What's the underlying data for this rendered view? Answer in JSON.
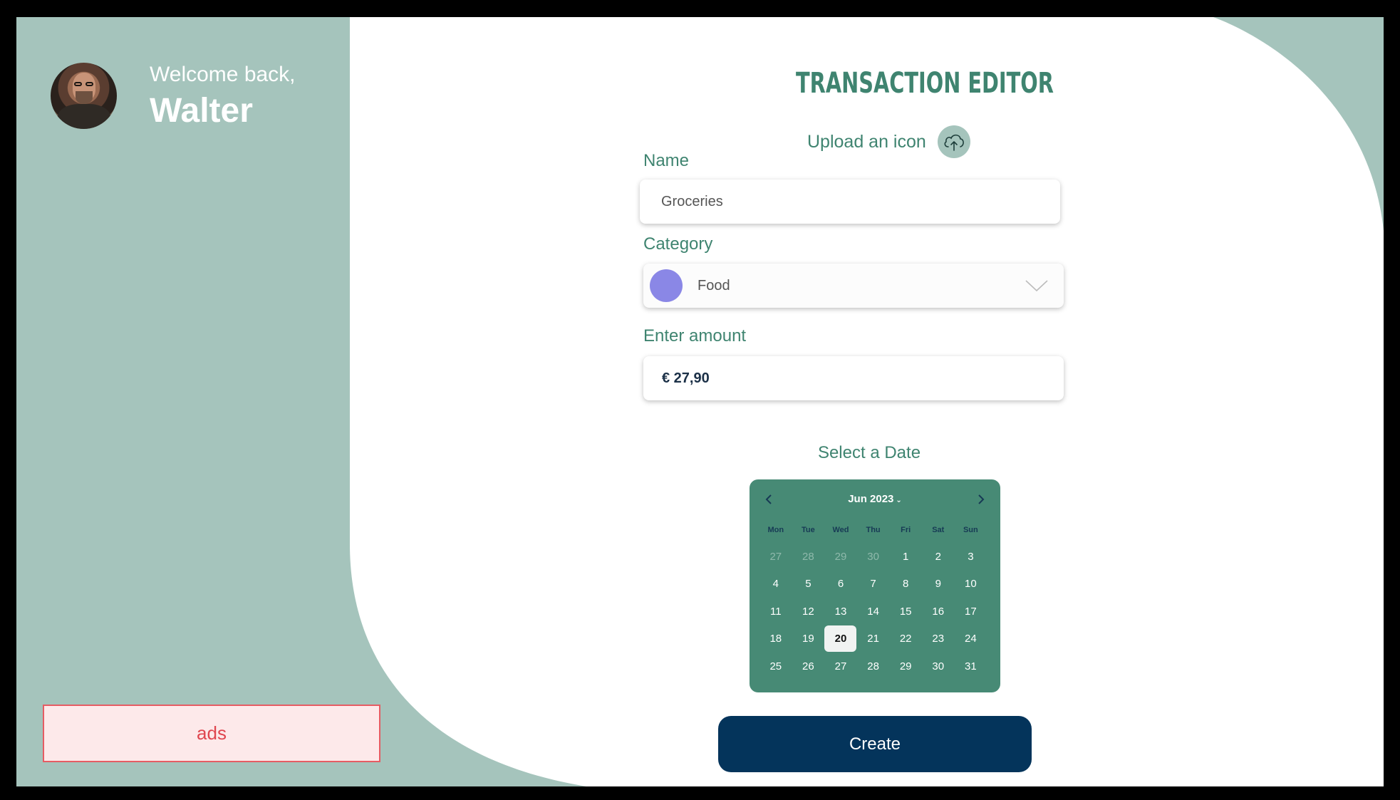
{
  "sidebar": {
    "welcome": "Welcome back,",
    "username": "Walter",
    "ads_label": "ads"
  },
  "editor": {
    "title": "TRANSACTION EDITOR",
    "upload_label": "Upload an icon",
    "upload_icon": "cloud-upload-icon",
    "name_label": "Name",
    "name_value": "Groceries",
    "category_label": "Category",
    "category_value": "Food",
    "category_color": "#8a87e6",
    "amount_label": "Enter amount",
    "amount_value": "€ 27,90",
    "date_label": "Select a Date",
    "create_label": "Create"
  },
  "calendar": {
    "month_label": "Jun 2023",
    "weekdays": [
      "Mon",
      "Tue",
      "Wed",
      "Thu",
      "Fri",
      "Sat",
      "Sun"
    ],
    "days": [
      {
        "d": "27",
        "muted": true
      },
      {
        "d": "28",
        "muted": true
      },
      {
        "d": "29",
        "muted": true
      },
      {
        "d": "30",
        "muted": true
      },
      {
        "d": "1"
      },
      {
        "d": "2"
      },
      {
        "d": "3"
      },
      {
        "d": "4"
      },
      {
        "d": "5"
      },
      {
        "d": "6"
      },
      {
        "d": "7"
      },
      {
        "d": "8"
      },
      {
        "d": "9"
      },
      {
        "d": "10"
      },
      {
        "d": "11"
      },
      {
        "d": "12"
      },
      {
        "d": "13"
      },
      {
        "d": "14"
      },
      {
        "d": "15"
      },
      {
        "d": "16"
      },
      {
        "d": "17"
      },
      {
        "d": "18"
      },
      {
        "d": "19"
      },
      {
        "d": "20",
        "selected": true
      },
      {
        "d": "21"
      },
      {
        "d": "22"
      },
      {
        "d": "23"
      },
      {
        "d": "24"
      },
      {
        "d": "25"
      },
      {
        "d": "26"
      },
      {
        "d": "27"
      },
      {
        "d": "28"
      },
      {
        "d": "29"
      },
      {
        "d": "30"
      },
      {
        "d": "31"
      }
    ]
  },
  "colors": {
    "sidebar_bg": "#a5c4bc",
    "accent": "#3f8470",
    "calendar_bg": "#478a75",
    "button_bg": "#04345b",
    "ads_border": "#e65c63"
  }
}
